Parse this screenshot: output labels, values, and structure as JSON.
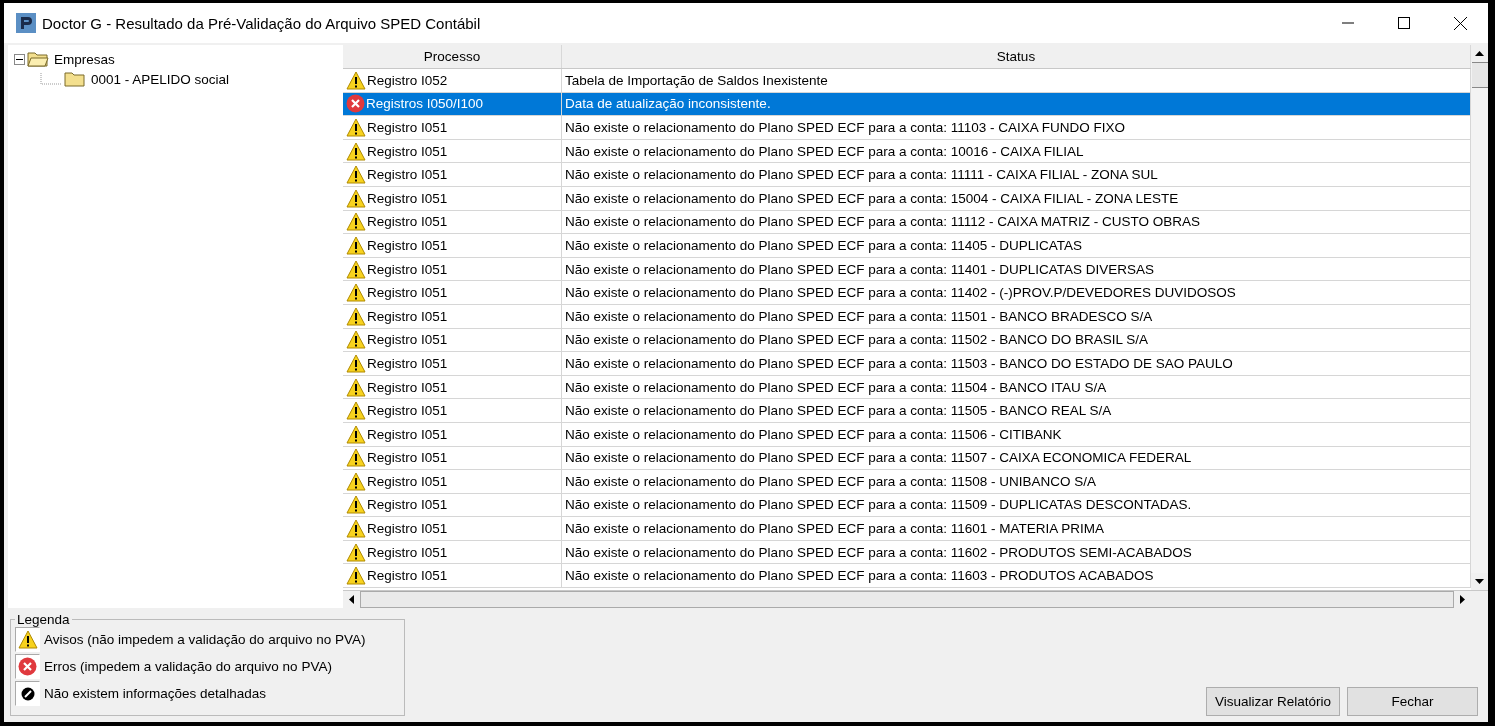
{
  "window": {
    "title": "Doctor G - Resultado da Pré-Validação do Arquivo SPED Contábil"
  },
  "tree": {
    "label": "Empresas",
    "expanded": true,
    "children": [
      {
        "label": "0001  - APELIDO social"
      }
    ]
  },
  "table": {
    "columns": [
      "Processo",
      "Status"
    ],
    "rows": [
      {
        "kind": "warning",
        "selected": false,
        "process": "Registro I052",
        "status": "Tabela de Importação de Saldos Inexistente"
      },
      {
        "kind": "error",
        "selected": true,
        "process": "Registros I050/I100",
        "status": "Data de atualização inconsistente."
      },
      {
        "kind": "warning",
        "selected": false,
        "process": "Registro I051",
        "status": "Não existe o relacionamento do Plano SPED ECF para a conta: 11103 - CAIXA FUNDO FIXO"
      },
      {
        "kind": "warning",
        "selected": false,
        "process": "Registro I051",
        "status": "Não existe o relacionamento do Plano SPED ECF para a conta: 10016 - CAIXA FILIAL"
      },
      {
        "kind": "warning",
        "selected": false,
        "process": "Registro I051",
        "status": "Não existe o relacionamento do Plano SPED ECF para a conta: 11111 - CAIXA FILIAL - ZONA SUL"
      },
      {
        "kind": "warning",
        "selected": false,
        "process": "Registro I051",
        "status": "Não existe o relacionamento do Plano SPED ECF para a conta: 15004 - CAIXA FILIAL - ZONA LESTE"
      },
      {
        "kind": "warning",
        "selected": false,
        "process": "Registro I051",
        "status": "Não existe o relacionamento do Plano SPED ECF para a conta: 11112 - CAIXA MATRIZ - CUSTO OBRAS"
      },
      {
        "kind": "warning",
        "selected": false,
        "process": "Registro I051",
        "status": "Não existe o relacionamento do Plano SPED ECF para a conta: 11405 - DUPLICATAS"
      },
      {
        "kind": "warning",
        "selected": false,
        "process": "Registro I051",
        "status": "Não existe o relacionamento do Plano SPED ECF para a conta: 11401 - DUPLICATAS DIVERSAS"
      },
      {
        "kind": "warning",
        "selected": false,
        "process": "Registro I051",
        "status": "Não existe o relacionamento do Plano SPED ECF para a conta: 11402 - (-)PROV.P/DEVEDORES DUVIDOSOS"
      },
      {
        "kind": "warning",
        "selected": false,
        "process": "Registro I051",
        "status": "Não existe o relacionamento do Plano SPED ECF para a conta: 11501 - BANCO BRADESCO S/A"
      },
      {
        "kind": "warning",
        "selected": false,
        "process": "Registro I051",
        "status": "Não existe o relacionamento do Plano SPED ECF para a conta: 11502 - BANCO DO BRASIL S/A"
      },
      {
        "kind": "warning",
        "selected": false,
        "process": "Registro I051",
        "status": "Não existe o relacionamento do Plano SPED ECF para a conta: 11503 - BANCO DO ESTADO DE SAO PAULO"
      },
      {
        "kind": "warning",
        "selected": false,
        "process": "Registro I051",
        "status": "Não existe o relacionamento do Plano SPED ECF para a conta: 11504 - BANCO ITAU S/A"
      },
      {
        "kind": "warning",
        "selected": false,
        "process": "Registro I051",
        "status": "Não existe o relacionamento do Plano SPED ECF para a conta: 11505 - BANCO REAL S/A"
      },
      {
        "kind": "warning",
        "selected": false,
        "process": "Registro I051",
        "status": "Não existe o relacionamento do Plano SPED ECF para a conta: 11506 - CITIBANK"
      },
      {
        "kind": "warning",
        "selected": false,
        "process": "Registro I051",
        "status": "Não existe o relacionamento do Plano SPED ECF para a conta: 11507 - CAIXA ECONOMICA FEDERAL"
      },
      {
        "kind": "warning",
        "selected": false,
        "process": "Registro I051",
        "status": "Não existe o relacionamento do Plano SPED ECF para a conta: 11508 - UNIBANCO S/A"
      },
      {
        "kind": "warning",
        "selected": false,
        "process": "Registro I051",
        "status": "Não existe o relacionamento do Plano SPED ECF para a conta: 11509 - DUPLICATAS DESCONTADAS."
      },
      {
        "kind": "warning",
        "selected": false,
        "process": "Registro I051",
        "status": "Não existe o relacionamento do Plano SPED ECF para a conta: 11601 - MATERIA PRIMA"
      },
      {
        "kind": "warning",
        "selected": false,
        "process": "Registro I051",
        "status": "Não existe o relacionamento do Plano SPED ECF para a conta: 11602 - PRODUTOS SEMI-ACABADOS"
      },
      {
        "kind": "warning",
        "selected": false,
        "process": "Registro I051",
        "status": "Não existe o relacionamento do Plano SPED ECF para a conta: 11603 - PRODUTOS ACABADOS"
      }
    ]
  },
  "legend": {
    "title": "Legenda",
    "items": [
      {
        "kind": "warning",
        "label": "Avisos (não impedem a validação do arquivo no PVA)"
      },
      {
        "kind": "error",
        "label": "Erros (impedem a validação do arquivo no PVA)"
      },
      {
        "kind": "none",
        "label": "Não existem informações detalhadas"
      }
    ]
  },
  "buttons": [
    "Visualizar Relatório",
    "Fechar"
  ]
}
